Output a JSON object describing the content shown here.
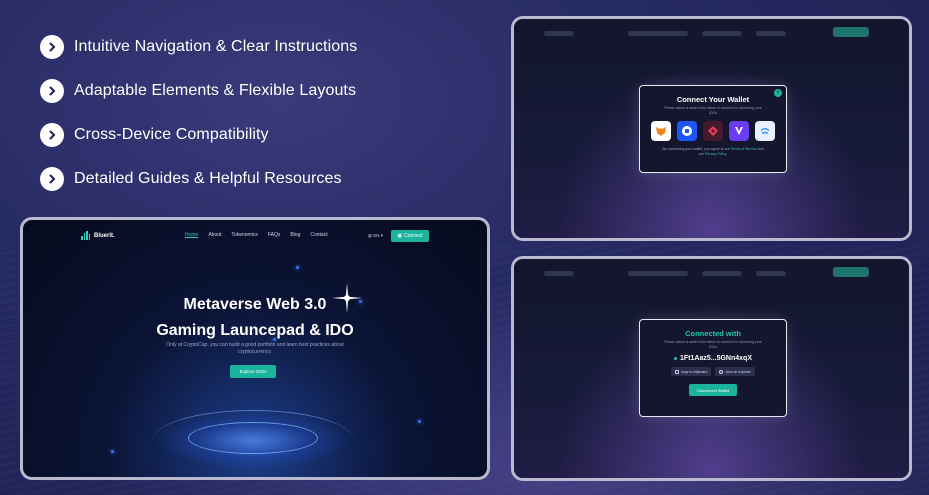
{
  "features": [
    {
      "label": "Intuitive Navigation & Clear Instructions"
    },
    {
      "label": "Adaptable Elements & Flexible Layouts"
    },
    {
      "label": "Cross-Device Compatibility"
    },
    {
      "label": "Detailed Guides & Helpful Resources"
    }
  ],
  "landing": {
    "brand": "Bluerit.",
    "nav": [
      "Home",
      "About",
      "Tokenomics",
      "FAQs",
      "Blog",
      "Contact"
    ],
    "lang": "EN",
    "connect_label": "Connect",
    "hero_line1": "Metaverse Web 3.0",
    "hero_line2": "Gaming Launcepad & IDO",
    "hero_sub": "Only at CryptoCap, you can build a good portfolio and learn best practices about cryptocurrency.",
    "cta": "Explore IDOs"
  },
  "connect_modal": {
    "title": "Connect Your Wallet",
    "subtitle": "Please select a wallet from below to connect for launching your IDOs",
    "close": "×",
    "wallets": [
      "metamask-icon",
      "coinbase-icon",
      "trust-wallet-icon",
      "vault-icon",
      "walletconnect-icon"
    ],
    "legal_prefix": "By connecting your wallet, you agree to our",
    "terms": "Terms of Service",
    "legal_mid": "and our",
    "privacy": "Privacy Policy."
  },
  "connected_modal": {
    "title": "Connected with",
    "subtitle": "Please select a wallet from below to connect for launching your IDOs",
    "address": "1Ft1Aaz5...5GNn4xqX",
    "copy": "copy to clipboard",
    "explorer": "view on explorer",
    "disconnect": "Disconnect Wallet"
  },
  "colors": {
    "accent": "#1bb39d",
    "background": "#262a63"
  }
}
